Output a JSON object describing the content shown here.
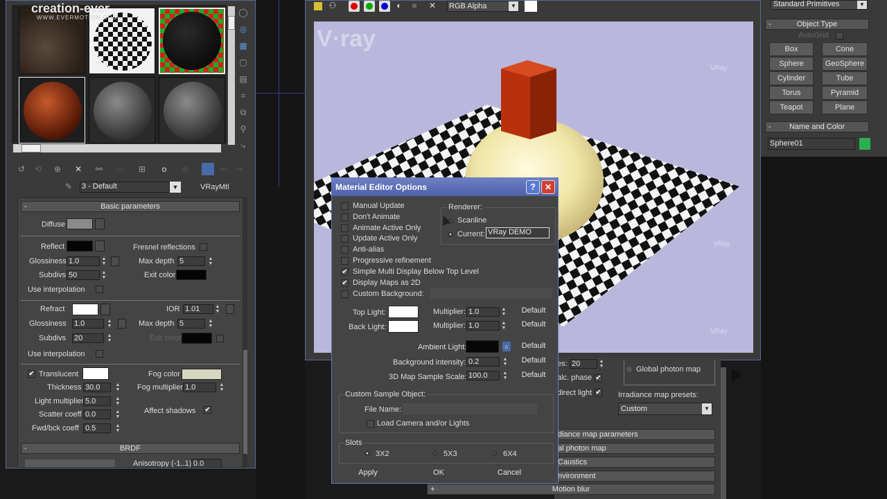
{
  "watermark": {
    "line1": "creation-ever",
    "line2": "WWW.EVERMOTION.ORG"
  },
  "mat_editor": {
    "material_name": "3 - Default",
    "material_type": "VRayMtl",
    "basic_rollout": "Basic parameters",
    "brdf_rollout": "BRDF",
    "diffuse": "Diffuse",
    "reflect": "Reflect",
    "fresnel": "Fresnel reflections",
    "glossiness": "Glossiness",
    "refl_gloss": "1.0",
    "max_depth": "Max depth",
    "refl_depth": "5",
    "subdivs": "Subdivs",
    "refl_subdivs": "50",
    "exit_color": "Exit color",
    "use_interp": "Use interpolation",
    "refract": "Refract",
    "ior": "IOR",
    "ior_val": "1.01",
    "refr_gloss": "1.0",
    "refr_depth": "5",
    "refr_subdivs": "20",
    "translucent": "Translucent",
    "fog_color": "Fog color",
    "thickness": "Thickness",
    "thickness_val": "30.0",
    "fog_mult": "Fog multiplier",
    "fog_mult_val": "1.0",
    "light_mult": "Light multiplier",
    "light_mult_val": "5.0",
    "affect_shadows": "Affect shadows",
    "scatter": "Scatter coeff",
    "scatter_val": "0.0",
    "fwd": "Fwd/bck coeff",
    "fwd_val": "0.5",
    "aniso": "Anisotropy (-1..1)",
    "aniso_val": "0.0"
  },
  "frame_buffer": {
    "channel": "RGB Alpha",
    "vray": "VRay",
    "logo": "V·ray"
  },
  "command_panel": {
    "primitives": "Standard Primitives",
    "object_type": "Object Type",
    "autogrid": "AutoGrid",
    "buttons": [
      "Box",
      "Cone",
      "Sphere",
      "GeoSphere",
      "Cylinder",
      "Tube",
      "Torus",
      "Pyramid",
      "Teapot",
      "Plane"
    ],
    "name_color": "Name and Color",
    "object_name": "Sphere01"
  },
  "render_panel": {
    "subdivs_label": "es:",
    "subdivs_val": "20",
    "calc_phase": "alc. phase",
    "direct_light": "direct light",
    "global_photon": "Global photon map",
    "presets_label": "Irradiance map presets:",
    "preset": "Custom",
    "rollouts": [
      "diance map parameters",
      "al photon map",
      "Caustics",
      "nvironment"
    ],
    "motion_blur": "Motion blur",
    "plus": "+"
  },
  "dialog": {
    "title": "Material Editor Options",
    "help": "?",
    "close": "✕",
    "options": [
      {
        "label": "Manual Update",
        "checked": false
      },
      {
        "label": "Don't Animate",
        "checked": false
      },
      {
        "label": "Animate Active Only",
        "checked": false
      },
      {
        "label": "Update Active Only",
        "checked": false
      },
      {
        "label": "Anti-alias",
        "checked": false
      },
      {
        "label": "Progressive refinement",
        "checked": false
      },
      {
        "label": "Simple Multi Display Below Top Level",
        "checked": true
      },
      {
        "label": "Display Maps as 2D",
        "checked": true
      },
      {
        "label": "Custom Background:",
        "checked": false
      }
    ],
    "renderer_group": "Renderer:",
    "scanline": "Scanline",
    "current": "Current:",
    "current_val": "VRay DEMO",
    "top_light": "Top Light:",
    "back_light": "Back Light:",
    "multiplier": "Multiplier:",
    "top_mult": "1.0",
    "back_mult": "1.0",
    "default": "Default",
    "ambient": "Ambient Light:",
    "bg_intensity": "Background intensity:",
    "bg_val": "0.2",
    "map_sample": "3D Map Sample Scale:",
    "map_val": "100.0",
    "custom_sample": "Custom Sample Object:",
    "file_name": "File Name:",
    "load_camera": "Load Camera and/or Lights",
    "slots": "Slots",
    "slot_opts": [
      "3X2",
      "5X3",
      "6X4"
    ],
    "apply": "Apply",
    "ok": "OK",
    "cancel": "Cancel"
  }
}
